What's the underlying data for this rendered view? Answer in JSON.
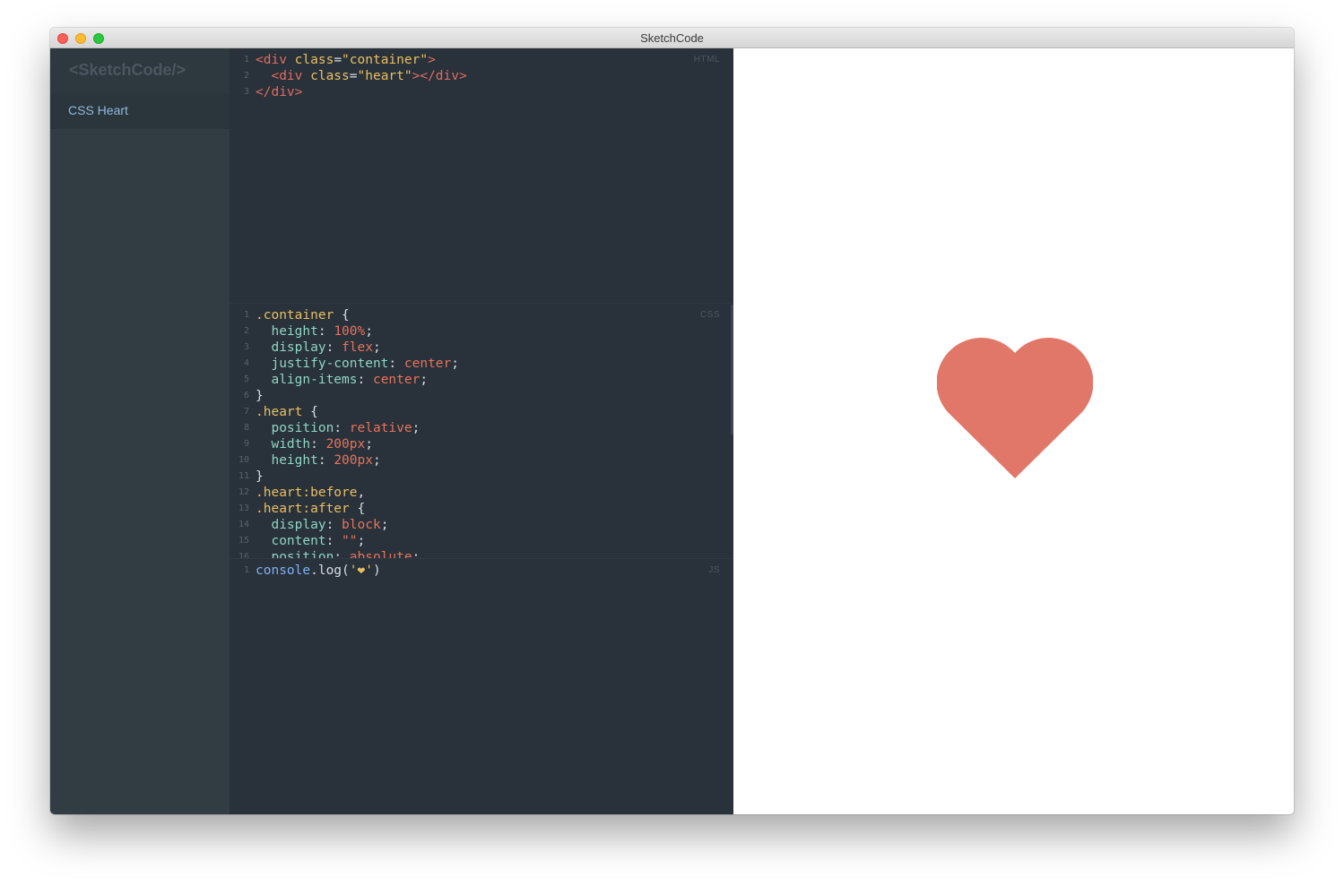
{
  "window": {
    "title": "SketchCode"
  },
  "sidebar": {
    "logo": "<SketchCode/>",
    "items": [
      {
        "label": "CSS Heart"
      }
    ]
  },
  "editors": {
    "html": {
      "label": "HTML",
      "lines": [
        [
          {
            "t": "<div ",
            "c": "tag"
          },
          {
            "t": "class",
            "c": "attr"
          },
          {
            "t": "=",
            "c": "punc"
          },
          {
            "t": "\"container\"",
            "c": "str"
          },
          {
            "t": ">",
            "c": "tag"
          }
        ],
        [
          {
            "t": "  <div ",
            "c": "tag"
          },
          {
            "t": "class",
            "c": "attr"
          },
          {
            "t": "=",
            "c": "punc"
          },
          {
            "t": "\"heart\"",
            "c": "str"
          },
          {
            "t": "></div>",
            "c": "tag"
          }
        ],
        [
          {
            "t": "</div>",
            "c": "tag"
          }
        ]
      ]
    },
    "css": {
      "label": "CSS",
      "lines": [
        [
          {
            "t": ".container",
            "c": "sel"
          },
          {
            "t": " {",
            "c": "punc"
          }
        ],
        [
          {
            "t": "  height",
            "c": "prop"
          },
          {
            "t": ": ",
            "c": "punc"
          },
          {
            "t": "100%",
            "c": "val"
          },
          {
            "t": ";",
            "c": "punc"
          }
        ],
        [
          {
            "t": "  display",
            "c": "prop"
          },
          {
            "t": ": ",
            "c": "punc"
          },
          {
            "t": "flex",
            "c": "val"
          },
          {
            "t": ";",
            "c": "punc"
          }
        ],
        [
          {
            "t": "  justify-content",
            "c": "prop"
          },
          {
            "t": ": ",
            "c": "punc"
          },
          {
            "t": "center",
            "c": "val"
          },
          {
            "t": ";",
            "c": "punc"
          }
        ],
        [
          {
            "t": "  align-items",
            "c": "prop"
          },
          {
            "t": ": ",
            "c": "punc"
          },
          {
            "t": "center",
            "c": "val"
          },
          {
            "t": ";",
            "c": "punc"
          }
        ],
        [
          {
            "t": "}",
            "c": "punc"
          }
        ],
        [
          {
            "t": ".heart",
            "c": "sel"
          },
          {
            "t": " {",
            "c": "punc"
          }
        ],
        [
          {
            "t": "  position",
            "c": "prop"
          },
          {
            "t": ": ",
            "c": "punc"
          },
          {
            "t": "relative",
            "c": "val"
          },
          {
            "t": ";",
            "c": "punc"
          }
        ],
        [
          {
            "t": "  width",
            "c": "prop"
          },
          {
            "t": ": ",
            "c": "punc"
          },
          {
            "t": "200px",
            "c": "val"
          },
          {
            "t": ";",
            "c": "punc"
          }
        ],
        [
          {
            "t": "  height",
            "c": "prop"
          },
          {
            "t": ": ",
            "c": "punc"
          },
          {
            "t": "200px",
            "c": "val"
          },
          {
            "t": ";",
            "c": "punc"
          }
        ],
        [
          {
            "t": "}",
            "c": "punc"
          }
        ],
        [
          {
            "t": ".heart",
            "c": "sel"
          },
          {
            "t": ":before",
            "c": "sel"
          },
          {
            "t": ",",
            "c": "punc"
          }
        ],
        [
          {
            "t": ".heart",
            "c": "sel"
          },
          {
            "t": ":after",
            "c": "sel"
          },
          {
            "t": " {",
            "c": "punc"
          }
        ],
        [
          {
            "t": "  display",
            "c": "prop"
          },
          {
            "t": ": ",
            "c": "punc"
          },
          {
            "t": "block",
            "c": "val"
          },
          {
            "t": ";",
            "c": "punc"
          }
        ],
        [
          {
            "t": "  content",
            "c": "prop"
          },
          {
            "t": ": ",
            "c": "punc"
          },
          {
            "t": "\"\"",
            "c": "val"
          },
          {
            "t": ";",
            "c": "punc"
          }
        ],
        [
          {
            "t": "  position",
            "c": "prop"
          },
          {
            "t": ": ",
            "c": "punc"
          },
          {
            "t": "absolute",
            "c": "val"
          },
          {
            "t": ";",
            "c": "punc"
          }
        ]
      ]
    },
    "js": {
      "label": "JS",
      "lines": [
        [
          {
            "t": "console",
            "c": "fn"
          },
          {
            "t": ".log(",
            "c": "punc"
          },
          {
            "t": "'",
            "c": "str"
          },
          {
            "t": "❤",
            "c": "heartglyph"
          },
          {
            "t": "'",
            "c": "str"
          },
          {
            "t": ")",
            "c": "punc"
          }
        ]
      ]
    }
  },
  "preview": {
    "heart_color": "#e17768"
  },
  "colors": {
    "sidebar_bg": "#313c43",
    "editor_bg": "#29313a",
    "accent_link": "#8fbbe0"
  }
}
